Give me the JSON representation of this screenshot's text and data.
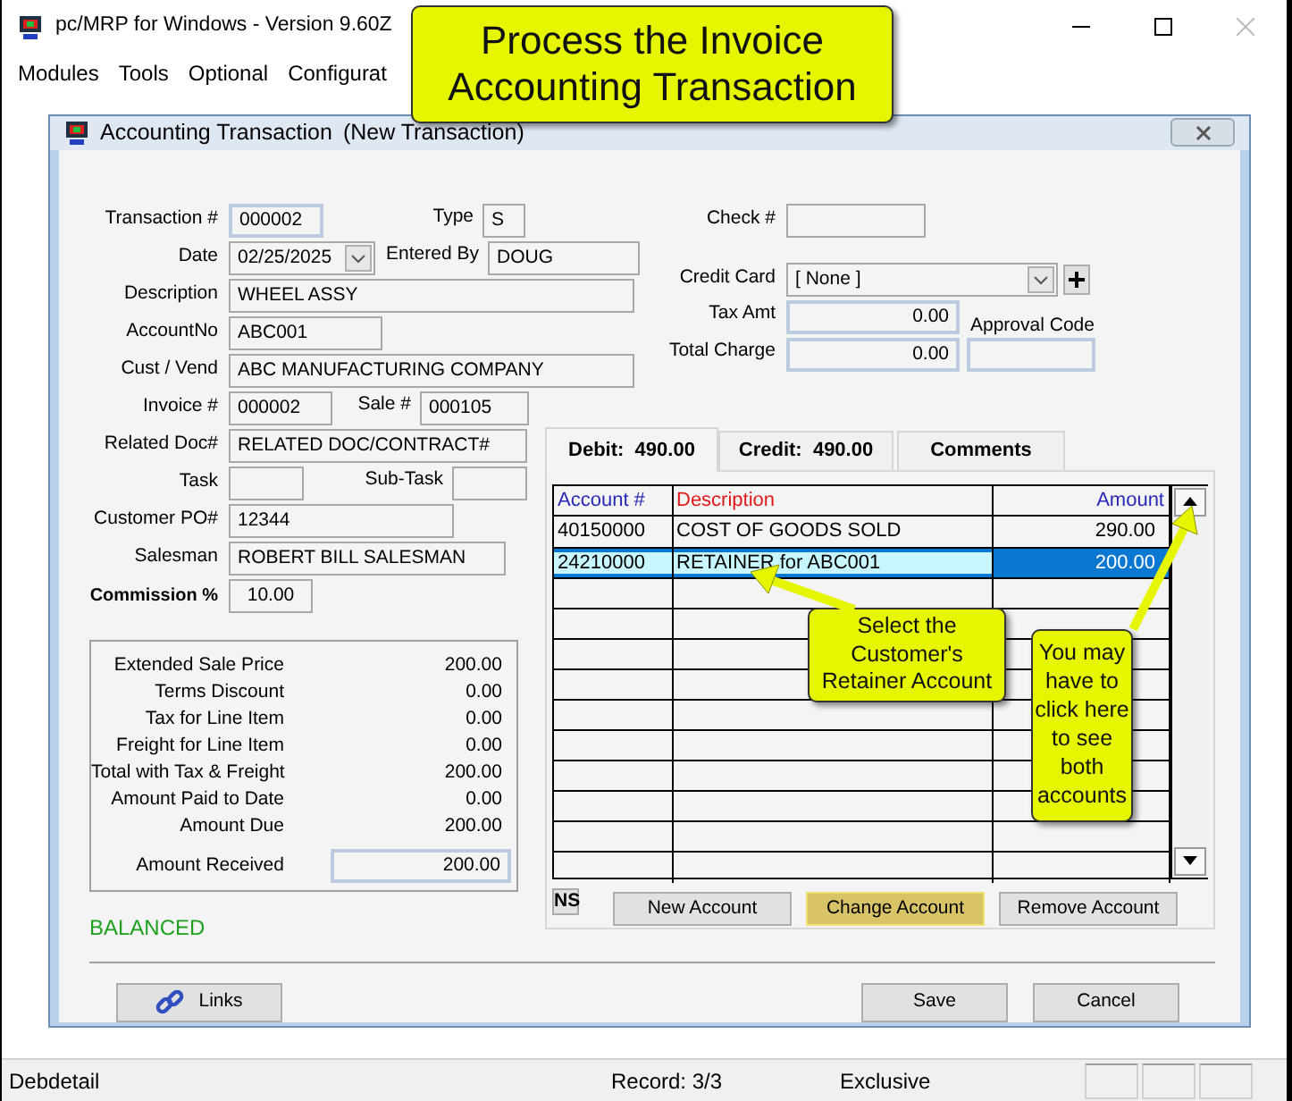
{
  "app": {
    "title": "pc/MRP for Windows - Version 9.60Z",
    "menu": [
      "Modules",
      "Tools",
      "Optional",
      "Configurat"
    ]
  },
  "dialog": {
    "title": "Accounting Transaction",
    "subtitle": "(New Transaction)",
    "left_rows": [
      [
        {
          "label": "Transaction #",
          "value": "000002"
        },
        {
          "label": "Type",
          "value": "S"
        }
      ],
      [
        {
          "label": "Date",
          "value": "02/25/2025",
          "kind": "date"
        },
        {
          "label": "Entered By",
          "value": "DOUG"
        }
      ],
      [
        {
          "label": "Description",
          "value": "WHEEL ASSY"
        }
      ],
      [
        {
          "label": "AccountNo",
          "value": "ABC001"
        }
      ],
      [
        {
          "label": "Cust / Vend",
          "value": "ABC MANUFACTURING COMPANY"
        }
      ],
      [
        {
          "label": "Invoice #",
          "value": "000002"
        },
        {
          "label": "Sale #",
          "value": "000105"
        }
      ],
      [
        {
          "label": "Related Doc#",
          "value": "RELATED DOC/CONTRACT#"
        }
      ],
      [
        {
          "label": "Task"
        },
        {
          "label": "Sub-Task"
        }
      ],
      [
        {
          "label": "Customer PO#",
          "value": "12344"
        }
      ],
      [
        {
          "label": "Salesman",
          "value": "ROBERT BILL SALESMAN"
        }
      ],
      [
        {
          "label": "Commission %",
          "value": "10.00",
          "bold": true
        }
      ]
    ],
    "payment_fields": [
      {
        "label": "Check #",
        "kind": "text"
      },
      {
        "label": "Credit Card",
        "value": "[ None ]",
        "kind": "select"
      },
      {
        "label": "Tax Amt",
        "value": "0.00",
        "kind": "amount"
      },
      {
        "label": "Total Charge",
        "value": "0.00",
        "kind": "amount"
      }
    ],
    "approval_code": {
      "label": "Approval Code"
    },
    "summary": [
      {
        "label": "Extended Sale Price",
        "value": "200.00"
      },
      {
        "label": "Terms Discount",
        "value": "0.00"
      },
      {
        "label": "Tax for Line Item",
        "value": "0.00"
      },
      {
        "label": "Freight for Line Item",
        "value": "0.00"
      },
      {
        "label": "Total with Tax & Freight",
        "value": "200.00"
      },
      {
        "label": "Amount Paid to Date",
        "value": "0.00"
      },
      {
        "label": "Amount Due",
        "value": "200.00"
      }
    ],
    "amount_received": {
      "label": "Amount Received",
      "value": "200.00"
    },
    "balance_status": "BALANCED",
    "tabs": [
      {
        "label": "Debit:  490.00",
        "selected": true
      },
      {
        "label": "Credit:  490.00",
        "selected": false
      },
      {
        "label": "Comments",
        "selected": false
      }
    ],
    "grid": {
      "columns": [
        "Account #",
        "Description",
        "Amount"
      ],
      "rows": [
        {
          "account": "40150000",
          "description": "COST OF GOODS SOLD",
          "amount": "290.00",
          "selected": false
        },
        {
          "account": "24210000",
          "description": "RETAINER for ABC001",
          "amount": "200.00",
          "selected": true
        }
      ]
    },
    "ns_button": "NS",
    "grid_buttons": [
      {
        "label": "New Account",
        "highlighted": false
      },
      {
        "label": "Change Account",
        "highlighted": true
      },
      {
        "label": "Remove Account",
        "highlighted": false
      }
    ],
    "links_button": "Links",
    "buttons": [
      "Save",
      "Cancel"
    ]
  },
  "status_bar": {
    "panes": [
      "Debdetail",
      "Record: 3/3",
      "Exclusive"
    ]
  },
  "callouts": [
    {
      "text": "Process the Invoice Accounting Transaction"
    },
    {
      "text": "Select the Customer's Retainer Account"
    },
    {
      "text": "You may have to click here to see both accounts"
    }
  ]
}
